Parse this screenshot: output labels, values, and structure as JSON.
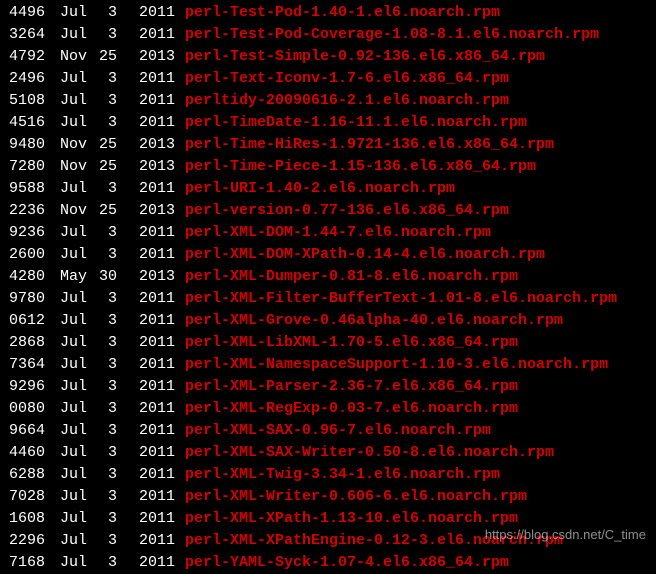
{
  "rows": [
    {
      "size": "4496",
      "month": "Jul",
      "day": "3",
      "year": "2011",
      "filename": "perl-Test-Pod-1.40-1.el6.noarch.rpm"
    },
    {
      "size": "3264",
      "month": "Jul",
      "day": "3",
      "year": "2011",
      "filename": "perl-Test-Pod-Coverage-1.08-8.1.el6.noarch.rpm"
    },
    {
      "size": "4792",
      "month": "Nov",
      "day": "25",
      "year": "2013",
      "filename": "perl-Test-Simple-0.92-136.el6.x86_64.rpm"
    },
    {
      "size": "2496",
      "month": "Jul",
      "day": "3",
      "year": "2011",
      "filename": "perl-Text-Iconv-1.7-6.el6.x86_64.rpm"
    },
    {
      "size": "5108",
      "month": "Jul",
      "day": "3",
      "year": "2011",
      "filename": "perltidy-20090616-2.1.el6.noarch.rpm"
    },
    {
      "size": "4516",
      "month": "Jul",
      "day": "3",
      "year": "2011",
      "filename": "perl-TimeDate-1.16-11.1.el6.noarch.rpm"
    },
    {
      "size": "9480",
      "month": "Nov",
      "day": "25",
      "year": "2013",
      "filename": "perl-Time-HiRes-1.9721-136.el6.x86_64.rpm"
    },
    {
      "size": "7280",
      "month": "Nov",
      "day": "25",
      "year": "2013",
      "filename": "perl-Time-Piece-1.15-136.el6.x86_64.rpm"
    },
    {
      "size": "9588",
      "month": "Jul",
      "day": "3",
      "year": "2011",
      "filename": "perl-URI-1.40-2.el6.noarch.rpm"
    },
    {
      "size": "2236",
      "month": "Nov",
      "day": "25",
      "year": "2013",
      "filename": "perl-version-0.77-136.el6.x86_64.rpm"
    },
    {
      "size": "9236",
      "month": "Jul",
      "day": "3",
      "year": "2011",
      "filename": "perl-XML-DOM-1.44-7.el6.noarch.rpm"
    },
    {
      "size": "2600",
      "month": "Jul",
      "day": "3",
      "year": "2011",
      "filename": "perl-XML-DOM-XPath-0.14-4.el6.noarch.rpm"
    },
    {
      "size": "4280",
      "month": "May",
      "day": "30",
      "year": "2013",
      "filename": "perl-XML-Dumper-0.81-8.el6.noarch.rpm"
    },
    {
      "size": "9780",
      "month": "Jul",
      "day": "3",
      "year": "2011",
      "filename": "perl-XML-Filter-BufferText-1.01-8.el6.noarch.rpm"
    },
    {
      "size": "0612",
      "month": "Jul",
      "day": "3",
      "year": "2011",
      "filename": "perl-XML-Grove-0.46alpha-40.el6.noarch.rpm"
    },
    {
      "size": "2868",
      "month": "Jul",
      "day": "3",
      "year": "2011",
      "filename": "perl-XML-LibXML-1.70-5.el6.x86_64.rpm"
    },
    {
      "size": "7364",
      "month": "Jul",
      "day": "3",
      "year": "2011",
      "filename": "perl-XML-NamespaceSupport-1.10-3.el6.noarch.rpm"
    },
    {
      "size": "9296",
      "month": "Jul",
      "day": "3",
      "year": "2011",
      "filename": "perl-XML-Parser-2.36-7.el6.x86_64.rpm"
    },
    {
      "size": "0080",
      "month": "Jul",
      "day": "3",
      "year": "2011",
      "filename": "perl-XML-RegExp-0.03-7.el6.noarch.rpm"
    },
    {
      "size": "9664",
      "month": "Jul",
      "day": "3",
      "year": "2011",
      "filename": "perl-XML-SAX-0.96-7.el6.noarch.rpm"
    },
    {
      "size": "4460",
      "month": "Jul",
      "day": "3",
      "year": "2011",
      "filename": "perl-XML-SAX-Writer-0.50-8.el6.noarch.rpm"
    },
    {
      "size": "6288",
      "month": "Jul",
      "day": "3",
      "year": "2011",
      "filename": "perl-XML-Twig-3.34-1.el6.noarch.rpm"
    },
    {
      "size": "7028",
      "month": "Jul",
      "day": "3",
      "year": "2011",
      "filename": "perl-XML-Writer-0.606-6.el6.noarch.rpm"
    },
    {
      "size": "1608",
      "month": "Jul",
      "day": "3",
      "year": "2011",
      "filename": "perl-XML-XPath-1.13-10.el6.noarch.rpm"
    },
    {
      "size": "2296",
      "month": "Jul",
      "day": "3",
      "year": "2011",
      "filename": "perl-XML-XPathEngine-0.12-3.el6.noarch.rpm"
    },
    {
      "size": "7168",
      "month": "Jul",
      "day": "3",
      "year": "2011",
      "filename": "perl-YAML-Syck-1.07-4.el6.x86_64.rpm"
    }
  ],
  "watermark": "https://blog.csdn.net/C_time"
}
